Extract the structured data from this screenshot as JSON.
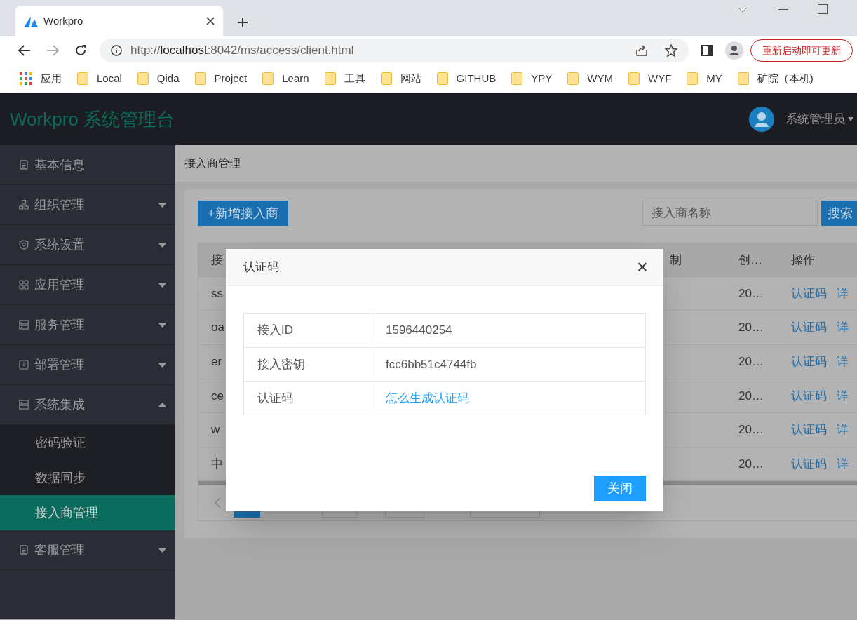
{
  "browser": {
    "tab_title": "Workpro",
    "url": {
      "scheme": "http://",
      "host": "localhost",
      "path": ":8042/ms/access/client.html"
    },
    "update_button": "重新启动即可更新",
    "bookmarks": [
      {
        "kind": "apps",
        "label": "应用"
      },
      {
        "kind": "folder",
        "label": "Local"
      },
      {
        "kind": "folder",
        "label": "Qida"
      },
      {
        "kind": "folder",
        "label": "Project"
      },
      {
        "kind": "folder",
        "label": "Learn"
      },
      {
        "kind": "folder",
        "label": "工具"
      },
      {
        "kind": "folder",
        "label": "网站"
      },
      {
        "kind": "folder",
        "label": "GITHUB"
      },
      {
        "kind": "folder",
        "label": "YPY"
      },
      {
        "kind": "folder",
        "label": "WYM"
      },
      {
        "kind": "folder",
        "label": "WYF"
      },
      {
        "kind": "folder",
        "label": "MY"
      },
      {
        "kind": "folder",
        "label": "矿院（本机)"
      }
    ]
  },
  "app": {
    "title": "Workpro 系统管理台",
    "user": "系统管理员",
    "sidebar": {
      "items": [
        {
          "label": "基本信息",
          "selected": false
        },
        {
          "label": "组织管理",
          "selected": false,
          "expanded": false
        },
        {
          "label": "系统设置",
          "selected": false,
          "expanded": false
        },
        {
          "label": "应用管理",
          "selected": false,
          "expanded": false
        },
        {
          "label": "服务管理",
          "selected": false,
          "expanded": false
        },
        {
          "label": "部署管理",
          "selected": false,
          "expanded": false
        },
        {
          "label": "系统集成",
          "selected": false,
          "expanded": true,
          "children": [
            {
              "label": "密码验证",
              "selected": false
            },
            {
              "label": "数据同步",
              "selected": false
            },
            {
              "label": "接入商管理",
              "selected": true
            }
          ]
        },
        {
          "label": "客服管理",
          "selected": false,
          "expanded": false
        }
      ]
    },
    "breadcrumb": "接入商管理",
    "add_button": "+新增接入商",
    "search": {
      "placeholder": "接入商名称"
    },
    "search_button": "搜索",
    "table": {
      "columns": [
        "接",
        "制",
        "创…",
        "操作"
      ],
      "rows": [
        {
          "column_1": "ss",
          "column_3": "20…",
          "actions": [
            "认证码",
            "详"
          ]
        },
        {
          "column_1": "oa",
          "column_3": "20…",
          "actions": [
            "认证码",
            "详"
          ]
        },
        {
          "column_1": "er",
          "column_3": "20…",
          "actions": [
            "认证码",
            "详"
          ]
        },
        {
          "column_1": "ce",
          "column_3": "20…",
          "actions": [
            "认证码",
            "详"
          ]
        },
        {
          "column_1": "w",
          "column_3": "20…",
          "actions": [
            "认证码",
            "详"
          ]
        },
        {
          "column_1": "中",
          "column_3": "20…",
          "actions": [
            "认证码",
            "详"
          ]
        }
      ]
    }
  },
  "modal": {
    "title": "认证码",
    "close": "×",
    "rows": [
      {
        "kind": "text",
        "label": "接入ID",
        "value": "1596440254"
      },
      {
        "kind": "text",
        "label": "接入密钥",
        "value": "fcc6bb51c4744fb"
      },
      {
        "kind": "link",
        "label": "认证码",
        "value": "怎么生成认证码"
      }
    ],
    "button": "关闭"
  }
}
